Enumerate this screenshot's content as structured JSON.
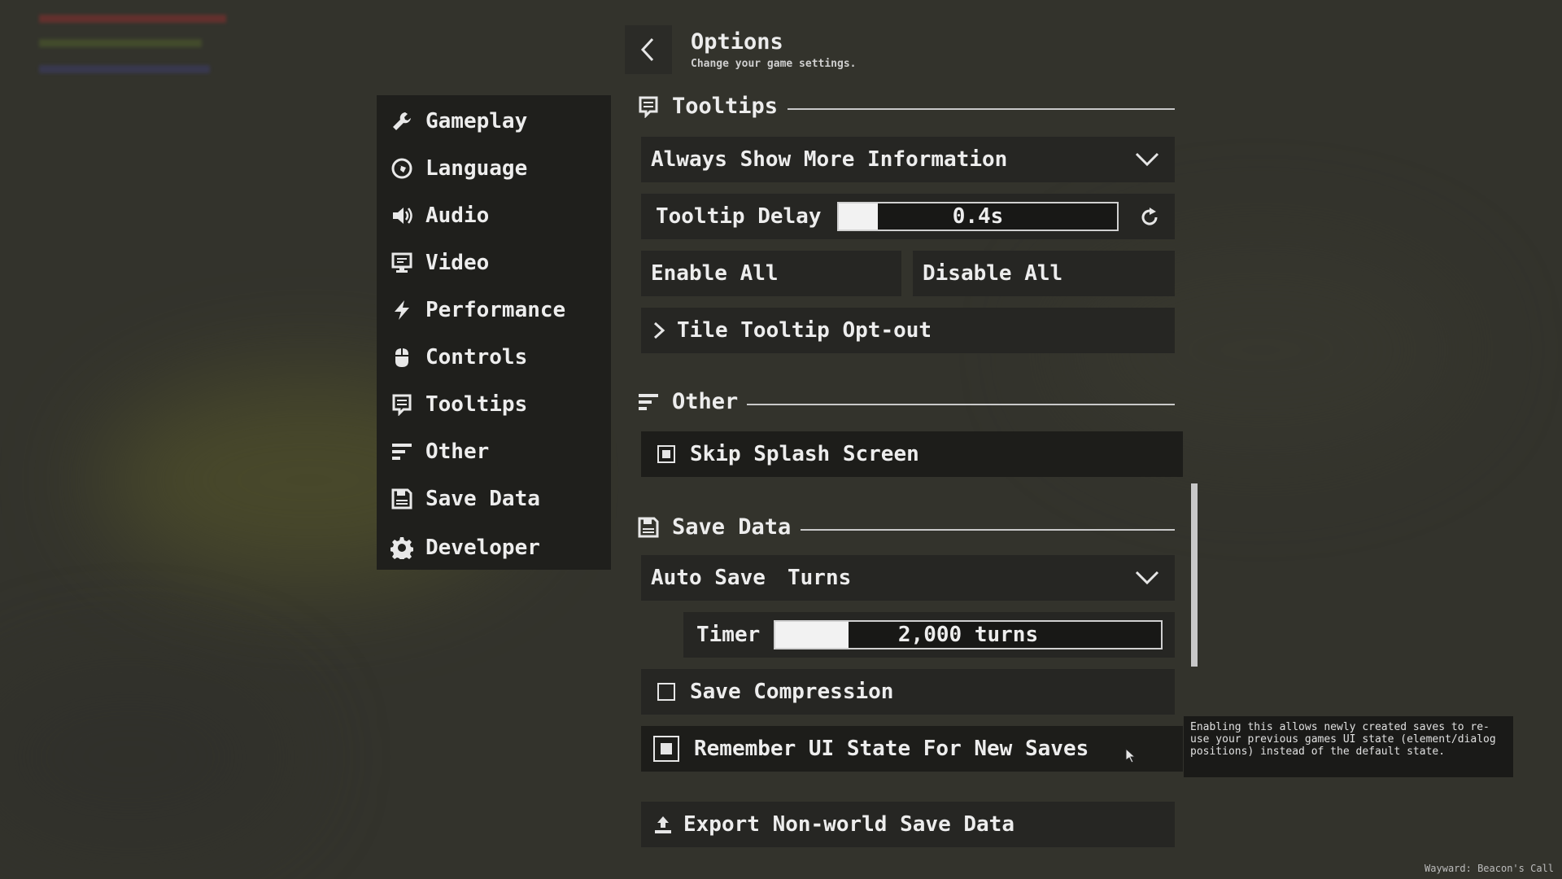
{
  "header": {
    "title": "Options",
    "subtitle": "Change your game settings.",
    "back_icon": "chevron-left-icon"
  },
  "sidebar": {
    "items": [
      {
        "label": "Gameplay",
        "icon": "wrench-icon"
      },
      {
        "label": "Language",
        "icon": "globe-icon"
      },
      {
        "label": "Audio",
        "icon": "speaker-icon"
      },
      {
        "label": "Video",
        "icon": "monitor-icon"
      },
      {
        "label": "Performance",
        "icon": "lightning-icon"
      },
      {
        "label": "Controls",
        "icon": "mouse-icon"
      },
      {
        "label": "Tooltips",
        "icon": "speech-bubble-icon"
      },
      {
        "label": "Other",
        "icon": "lines-icon"
      },
      {
        "label": "Save Data",
        "icon": "floppy-icon"
      },
      {
        "label": "Developer",
        "icon": "gear-icon"
      }
    ]
  },
  "tooltips_section": {
    "heading": "Tooltips",
    "mode_select": "Always Show More Information",
    "delay_label": "Tooltip Delay",
    "delay_value": "0.4s",
    "delay_fraction": 0.14,
    "enable_all": "Enable All",
    "disable_all": "Disable All",
    "tile_optout": "Tile Tooltip Opt-out"
  },
  "other_section": {
    "heading": "Other",
    "skip_splash": {
      "label": "Skip Splash Screen",
      "checked": true
    }
  },
  "save_section": {
    "heading": "Save Data",
    "auto_save_label": "Auto Save",
    "auto_save_value": "Turns",
    "timer_label": "Timer",
    "timer_value": "2,000 turns",
    "timer_fraction": 0.19,
    "save_compression": {
      "label": "Save Compression",
      "checked": false
    },
    "remember_ui": {
      "label": "Remember UI State For New Saves",
      "checked": true
    },
    "export_label": "Export Non-world Save Data"
  },
  "tooltip_popup": {
    "text": "Enabling this allows newly created saves to re-use your previous games UI state (element/dialog positions) instead of the default state."
  },
  "footer": {
    "version": "Wayward: Beacon's Call"
  }
}
